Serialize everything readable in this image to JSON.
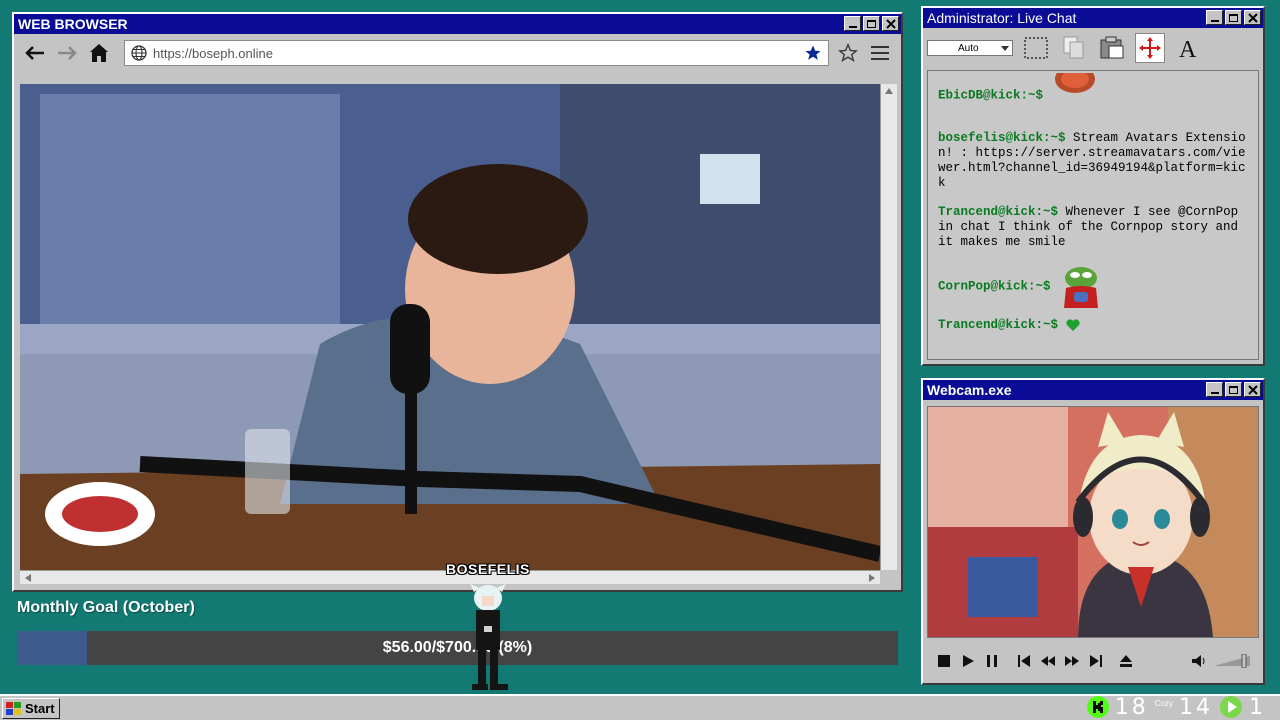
{
  "browser": {
    "title": "WEB BROWSER",
    "url": "https://boseph.online"
  },
  "chat": {
    "title": "Administrator: Live Chat",
    "select_value": "Auto",
    "messages": [
      {
        "user": "EbicDB@kick:~$",
        "text": ""
      },
      {
        "user": "bosefelis@kick:~$",
        "text": "Stream Avatars Extension! : https://server.streamavatars.com/viewer.html?channel_id=36949194&platform=kick"
      },
      {
        "user": "Trancend@kick:~$",
        "text": "Whenever I see @CornPop in chat I think of the Cornpop story and it makes me smile"
      },
      {
        "user": "CornPop@kick:~$",
        "text": ""
      },
      {
        "user": "Trancend@kick:~$",
        "text": ""
      }
    ]
  },
  "webcam": {
    "title": "Webcam.exe"
  },
  "goal": {
    "title": "Monthly Goal (October)",
    "text": "$56.00/$700.00 (8%)",
    "fraction": 0.08
  },
  "avatar": {
    "name": "BOSEFELIS"
  },
  "taskbar": {
    "start_label": "Start",
    "viewers": "18",
    "cozy_label": "Cozy",
    "count2": "14",
    "count3": "1"
  },
  "colors": {
    "desktop": "#127a73",
    "titlebar": "#0a0c96",
    "chat_user": "#0a7a22",
    "goal_fill": "#3c5b8c",
    "kick_green": "#53fc18"
  }
}
